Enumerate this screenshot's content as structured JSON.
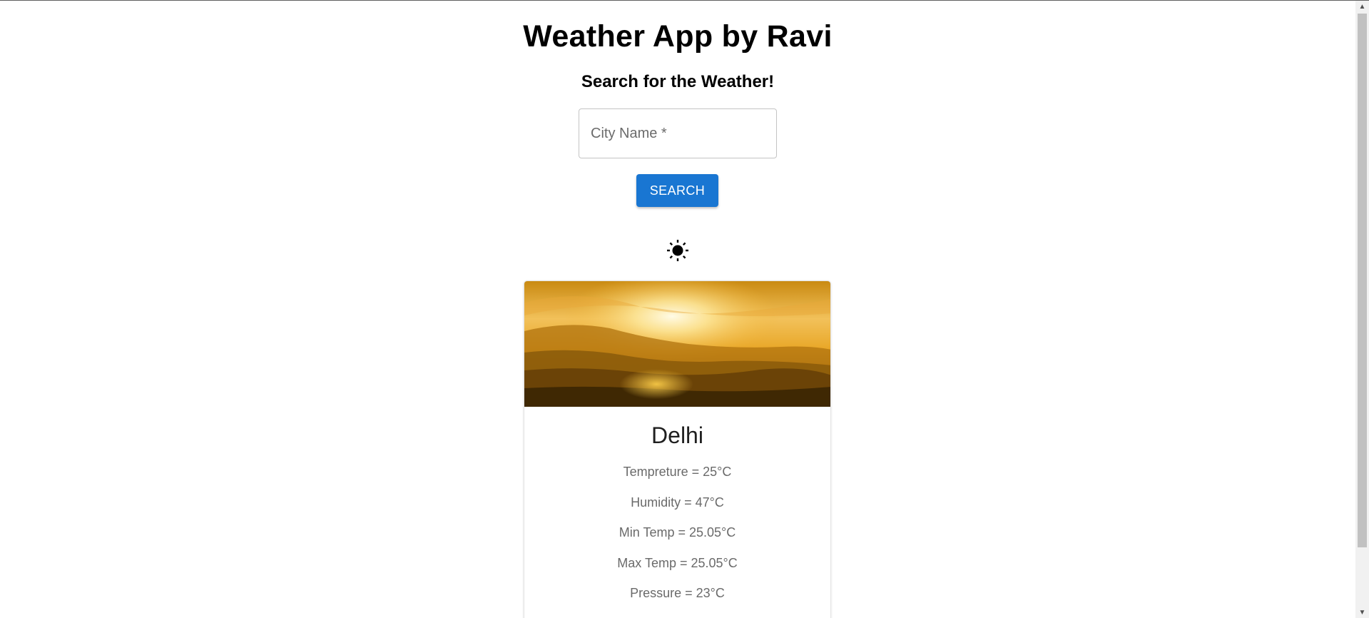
{
  "header": {
    "title": "Weather App by Ravi",
    "subtitle": "Search for the Weather!"
  },
  "search": {
    "placeholder": "City Name *",
    "button_label": "SEARCH"
  },
  "weather": {
    "icon": "sun-icon",
    "city": "Delhi",
    "temperature": "Tempreture = 25°C",
    "humidity": "Humidity = 47°C",
    "min_temp": "Min Temp = 25.05°C",
    "max_temp": "Max Temp = 25.05°C",
    "pressure": "Pressure = 23°C"
  },
  "colors": {
    "accent": "#1976d2"
  }
}
